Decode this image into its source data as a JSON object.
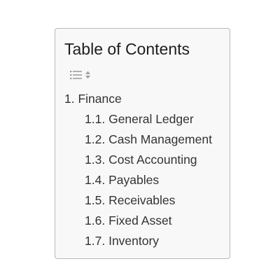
{
  "toc": {
    "title": "Table of Contents",
    "toggle_icon": "list-sort-icon",
    "items": [
      {
        "number": "1.",
        "label": "Finance",
        "level": 1
      },
      {
        "number": "1.1.",
        "label": "General Ledger",
        "level": 2
      },
      {
        "number": "1.2.",
        "label": "Cash Management",
        "level": 2
      },
      {
        "number": "1.3.",
        "label": "Cost Accounting",
        "level": 2
      },
      {
        "number": "1.4.",
        "label": "Payables",
        "level": 2
      },
      {
        "number": "1.5.",
        "label": "Receivables",
        "level": 2
      },
      {
        "number": "1.6.",
        "label": "Fixed Asset",
        "level": 2
      },
      {
        "number": "1.7.",
        "label": "Inventory",
        "level": 2
      }
    ]
  },
  "colors": {
    "background": "#f8f8f8",
    "border": "#b8b8b8",
    "text": "#333333",
    "icon": "#a0a0a0"
  }
}
